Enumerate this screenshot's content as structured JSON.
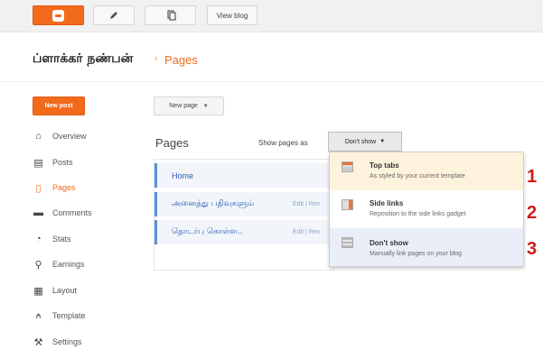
{
  "toolbar": {
    "view_blog_label": "View blog"
  },
  "header": {
    "blog_title": "ப்ளாக்கர் நண்பன்",
    "separator": "›",
    "current_section": "Pages"
  },
  "sidebar": {
    "new_post_label": "New post",
    "items": [
      {
        "label": "Overview",
        "icon": "home-icon"
      },
      {
        "label": "Posts",
        "icon": "posts-icon"
      },
      {
        "label": "Pages",
        "icon": "pages-icon",
        "active": true
      },
      {
        "label": "Comments",
        "icon": "comments-icon"
      },
      {
        "label": "Stats",
        "icon": "stats-icon"
      },
      {
        "label": "Earnings",
        "icon": "trophy-icon"
      },
      {
        "label": "Layout",
        "icon": "layout-icon"
      },
      {
        "label": "Template",
        "icon": "template-icon"
      },
      {
        "label": "Settings",
        "icon": "wrench-icon"
      }
    ]
  },
  "main": {
    "new_page_label": "New page",
    "heading": "Pages",
    "show_pages_label": "Show pages as",
    "show_pages_value": "Don't show",
    "pages": [
      {
        "title": "Home",
        "actions": ""
      },
      {
        "title": "அனைத்து பதிவுகளும்",
        "actions": "Edit | Rev"
      },
      {
        "title": "தொடர்பு கொள்ள..",
        "actions": "Edit | Rev"
      }
    ]
  },
  "menu": {
    "options": [
      {
        "title": "Top tabs",
        "description": "As styled by your current template",
        "callout": "1",
        "highlight": "#fdf3dc"
      },
      {
        "title": "Side links",
        "description": "Reposition to the side links gadget",
        "callout": "2"
      },
      {
        "title": "Don't show",
        "description": "Manually link pages on your blog",
        "callout": "3",
        "selected": true,
        "highlight": "#e9eef8"
      }
    ]
  },
  "colors": {
    "accent": "#f26a1b",
    "link": "#2a5db0",
    "callout": "#d11b1b"
  }
}
